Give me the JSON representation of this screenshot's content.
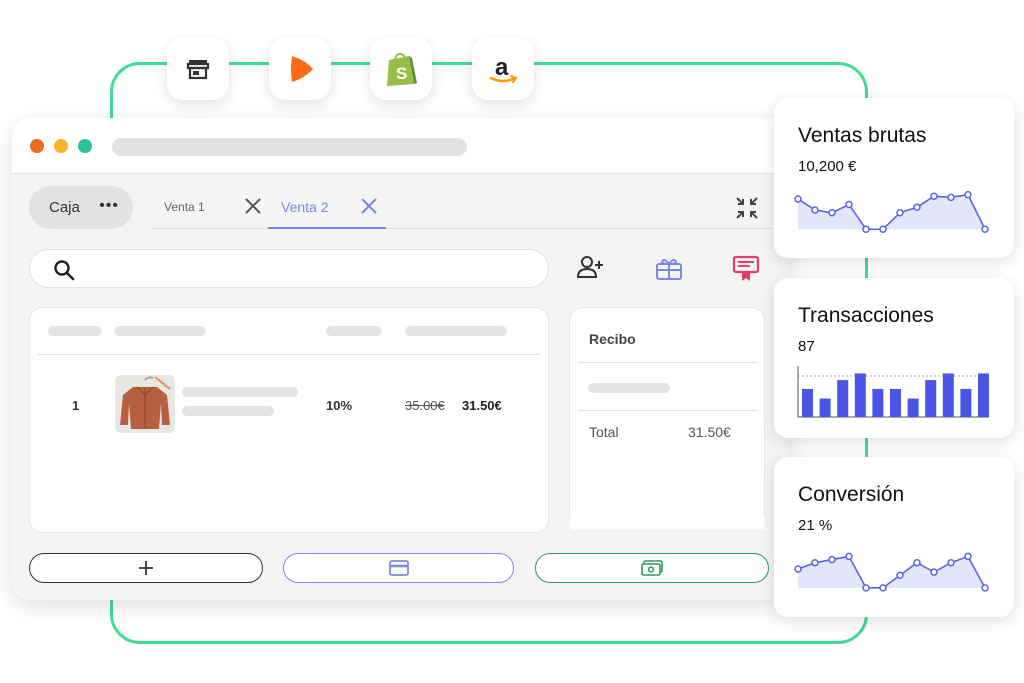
{
  "channels": [
    {
      "name": "store",
      "icon": "store-icon"
    },
    {
      "name": "zalando",
      "icon": "zalando-icon"
    },
    {
      "name": "shopify",
      "icon": "shopify-icon"
    },
    {
      "name": "amazon",
      "icon": "amazon-icon"
    }
  ],
  "window": {
    "caja_label": "Caja",
    "more_label": "•••",
    "tabs": [
      {
        "label": "Venta 1",
        "active": false
      },
      {
        "label": "Venta 2",
        "active": true
      }
    ],
    "accent_color": "#7b86e8"
  },
  "cart": {
    "rows": [
      {
        "qty": "1",
        "discount": "10%",
        "old_price": "35.00€",
        "new_price": "31.50€"
      }
    ]
  },
  "receipt": {
    "title": "Recibo",
    "total_label": "Total",
    "total_value": "31.50€"
  },
  "actions": [
    {
      "name": "add",
      "icon": "plus-icon",
      "color": "#333333"
    },
    {
      "name": "card-payment",
      "icon": "credit-card-icon",
      "color": "#7b86e8"
    },
    {
      "name": "cash-payment",
      "icon": "cash-icon",
      "color": "#2e9a62"
    }
  ],
  "cards": [
    {
      "title": "Ventas brutas",
      "value": "10,200 €",
      "chart_data": {
        "type": "area",
        "values": [
          6,
          4,
          3.5,
          5,
          0.5,
          0.5,
          3.5,
          4.5,
          6.5,
          6.3,
          6.8,
          0.5
        ],
        "ylim": [
          0,
          8
        ],
        "color": "#5a64e0"
      }
    },
    {
      "title": "Transacciones",
      "value": "87",
      "chart_data": {
        "type": "bar",
        "values": [
          3.8,
          2.5,
          5,
          5.9,
          3.8,
          3.8,
          2.5,
          5,
          5.9,
          3.8,
          5.9
        ],
        "ylim": [
          0,
          6.5
        ],
        "color": "#4a55e6"
      }
    },
    {
      "title": "Conversión",
      "value": "21 %",
      "chart_data": {
        "type": "area",
        "values": [
          3.5,
          4.5,
          5,
          5.5,
          0.5,
          0.5,
          2.5,
          4.5,
          3,
          4.5,
          5.5,
          0.5
        ],
        "ylim": [
          0,
          7
        ],
        "color": "#5a64e0"
      }
    }
  ]
}
